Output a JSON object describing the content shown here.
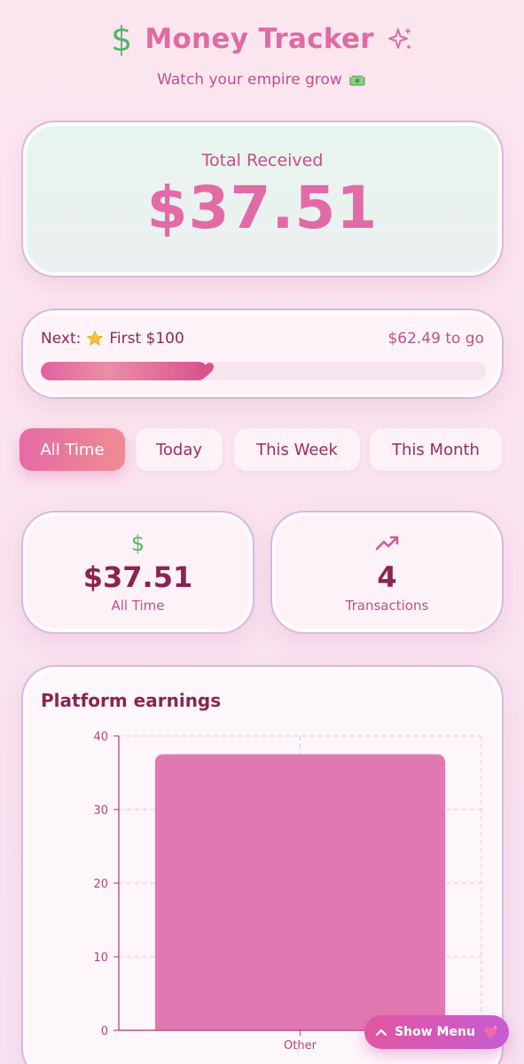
{
  "header": {
    "title": "Money Tracker",
    "subtitle": "Watch your empire grow"
  },
  "total": {
    "label": "Total Received",
    "value": "$37.51"
  },
  "progress": {
    "next_prefix": "Next:",
    "milestone": "First $100",
    "remaining": "$62.49 to go",
    "fraction": 0.3751
  },
  "tabs": [
    {
      "label": "All Time",
      "active": true
    },
    {
      "label": "Today",
      "active": false
    },
    {
      "label": "This Week",
      "active": false
    },
    {
      "label": "This Month",
      "active": false
    }
  ],
  "stats": [
    {
      "icon": "dollar-icon",
      "value": "$37.51",
      "label": "All Time"
    },
    {
      "icon": "trending-up-icon",
      "value": "4",
      "label": "Transactions"
    }
  ],
  "chart": {
    "title": "Platform earnings"
  },
  "chart_data": {
    "type": "bar",
    "title": "Platform earnings",
    "categories": [
      "Other"
    ],
    "values": [
      37.51
    ],
    "xlabel": "",
    "ylabel": "",
    "ylim": [
      0,
      40
    ],
    "yticks": [
      0,
      10,
      20,
      30,
      40
    ],
    "grid": true,
    "color": "#e278b2"
  },
  "menu": {
    "label": "Show Menu"
  },
  "colors": {
    "accent": "#e06aa3",
    "money_green": "#4fb86a",
    "text_dark": "#8a2451"
  }
}
